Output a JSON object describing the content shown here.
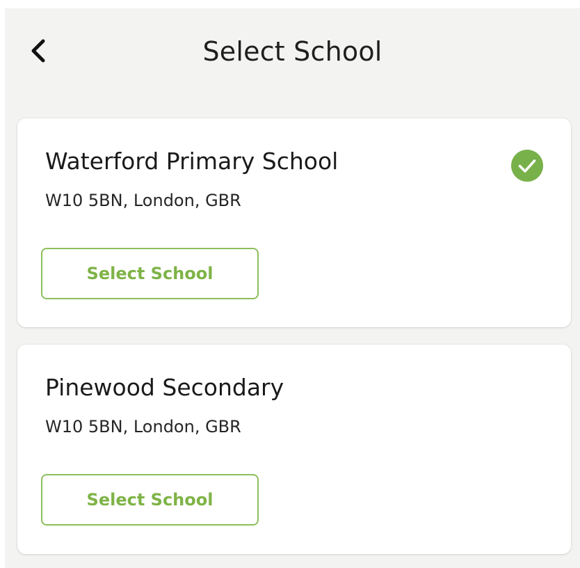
{
  "header": {
    "title": "Select School",
    "back_icon": "chevron-left-icon"
  },
  "colors": {
    "accent": "#7fb347",
    "check": "#78b14a",
    "background": "#f3f3f1"
  },
  "schools": [
    {
      "name": "Waterford Primary School",
      "address": "W10 5BN, London, GBR",
      "button_label": "Select School",
      "selected": true,
      "selected_icon": "check-circle-icon"
    },
    {
      "name": "Pinewood Secondary",
      "address": "W10 5BN, London, GBR",
      "button_label": "Select School",
      "selected": false
    }
  ]
}
